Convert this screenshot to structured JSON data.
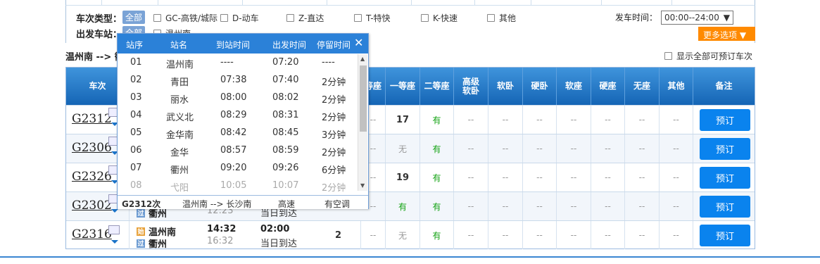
{
  "filters": {
    "train_type_label": "车次类型：",
    "all": "全部",
    "types": [
      "GC-高铁/城际",
      "D-动车",
      "Z-直达",
      "T-特快",
      "K-快速",
      "其他"
    ],
    "station_label": "出发车站：",
    "station_opt": "温州南",
    "depart_time_label": "发车时间：",
    "depart_time_value": "00:00--24:00",
    "more_options": "更多选项"
  },
  "route_text": "温州南 --> 衢",
  "show_all": "显示全部可预订车次",
  "headers": [
    "车次",
    "等座",
    "一等座",
    "二等座",
    "高级软卧",
    "软卧",
    "硬卧",
    "软座",
    "硬座",
    "无座",
    "其他",
    "备注"
  ],
  "rows": [
    {
      "train": "G2312",
      "c1": "--",
      "first": "17",
      "second": "有",
      "rest": [
        "--",
        "--",
        "--",
        "--",
        "--",
        "--",
        "--"
      ],
      "book": "预订"
    },
    {
      "train": "G2306",
      "c1": "--",
      "first": "无",
      "second": "有",
      "rest": [
        "--",
        "--",
        "--",
        "--",
        "--",
        "--",
        "--"
      ],
      "book": "预订"
    },
    {
      "train": "G2326",
      "c1": "--",
      "first": "19",
      "second": "有",
      "rest": [
        "--",
        "--",
        "--",
        "--",
        "--",
        "--",
        "--"
      ],
      "book": "预订"
    },
    {
      "train": "G2302",
      "from": "",
      "to": "衢州",
      "dep": "",
      "arr": "12:23",
      "note": "当日到达",
      "c1": "--",
      "first": "有",
      "second": "有",
      "rest": [
        "--",
        "--",
        "--",
        "--",
        "--",
        "--",
        "--"
      ],
      "book": "预订"
    },
    {
      "train": "G2316",
      "from": "温州南",
      "to": "衢州",
      "dep": "14:32",
      "arr": "16:32",
      "dur": "02:00",
      "note": "当日到达",
      "count": "2",
      "c1": "--",
      "first": "无",
      "second": "有",
      "rest": [
        "--",
        "--",
        "--",
        "--",
        "--",
        "--",
        "--"
      ],
      "book": "预订"
    }
  ],
  "tags": {
    "start": "始",
    "pass": "过"
  },
  "popup": {
    "headers": [
      "站序",
      "站名",
      "到站时间",
      "出发时间",
      "停留时间"
    ],
    "close": "✕",
    "stops": [
      {
        "no": "01",
        "name": "温州南",
        "arr": "----",
        "dep": "07:20",
        "stay": "----"
      },
      {
        "no": "02",
        "name": "青田",
        "arr": "07:38",
        "dep": "07:40",
        "stay": "2分钟"
      },
      {
        "no": "03",
        "name": "丽水",
        "arr": "08:00",
        "dep": "08:02",
        "stay": "2分钟"
      },
      {
        "no": "04",
        "name": "武义北",
        "arr": "08:29",
        "dep": "08:31",
        "stay": "2分钟"
      },
      {
        "no": "05",
        "name": "金华南",
        "arr": "08:42",
        "dep": "08:45",
        "stay": "3分钟"
      },
      {
        "no": "06",
        "name": "金华",
        "arr": "08:57",
        "dep": "08:59",
        "stay": "2分钟"
      },
      {
        "no": "07",
        "name": "衢州",
        "arr": "09:20",
        "dep": "09:26",
        "stay": "6分钟"
      },
      {
        "no": "08",
        "name": "弋阳",
        "arr": "10:05",
        "dep": "10:07",
        "stay": "2分钟"
      }
    ],
    "footer": {
      "train": "G2312次",
      "route": "温州南  -->  长沙南",
      "type": "高速",
      "ac": "有空调"
    }
  },
  "colors": {
    "header_blue": "#1565b5",
    "book_blue": "#0a83ee",
    "orange": "#ff8a00",
    "green": "#13a313"
  }
}
